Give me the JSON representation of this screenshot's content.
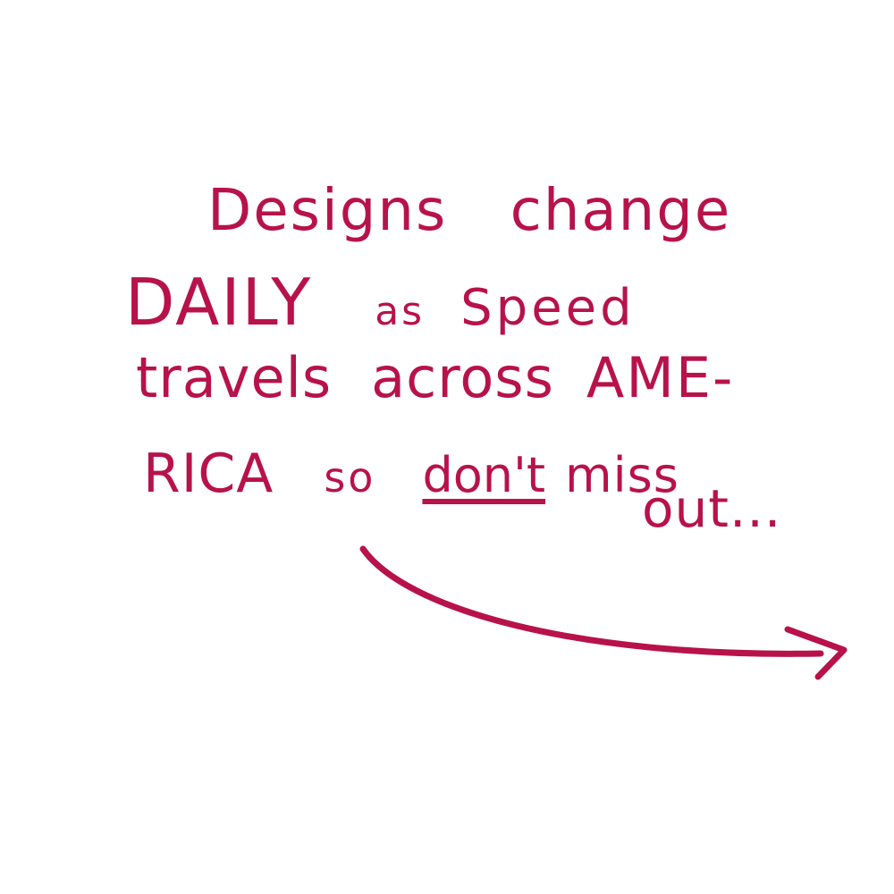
{
  "note": {
    "words": {
      "designs": "Designs",
      "change": "change",
      "daily": "DAILY",
      "as": "as",
      "speed": "Speed",
      "travels": "travels",
      "across": "across",
      "ame": "AME-",
      "rica": "RICA",
      "so": "so",
      "dont": "don't",
      "miss": "miss",
      "out": "out..."
    },
    "ink_color": "#b8124a",
    "background_color": "#ffffff",
    "arrow_icon": "curved-arrow-right-icon"
  }
}
